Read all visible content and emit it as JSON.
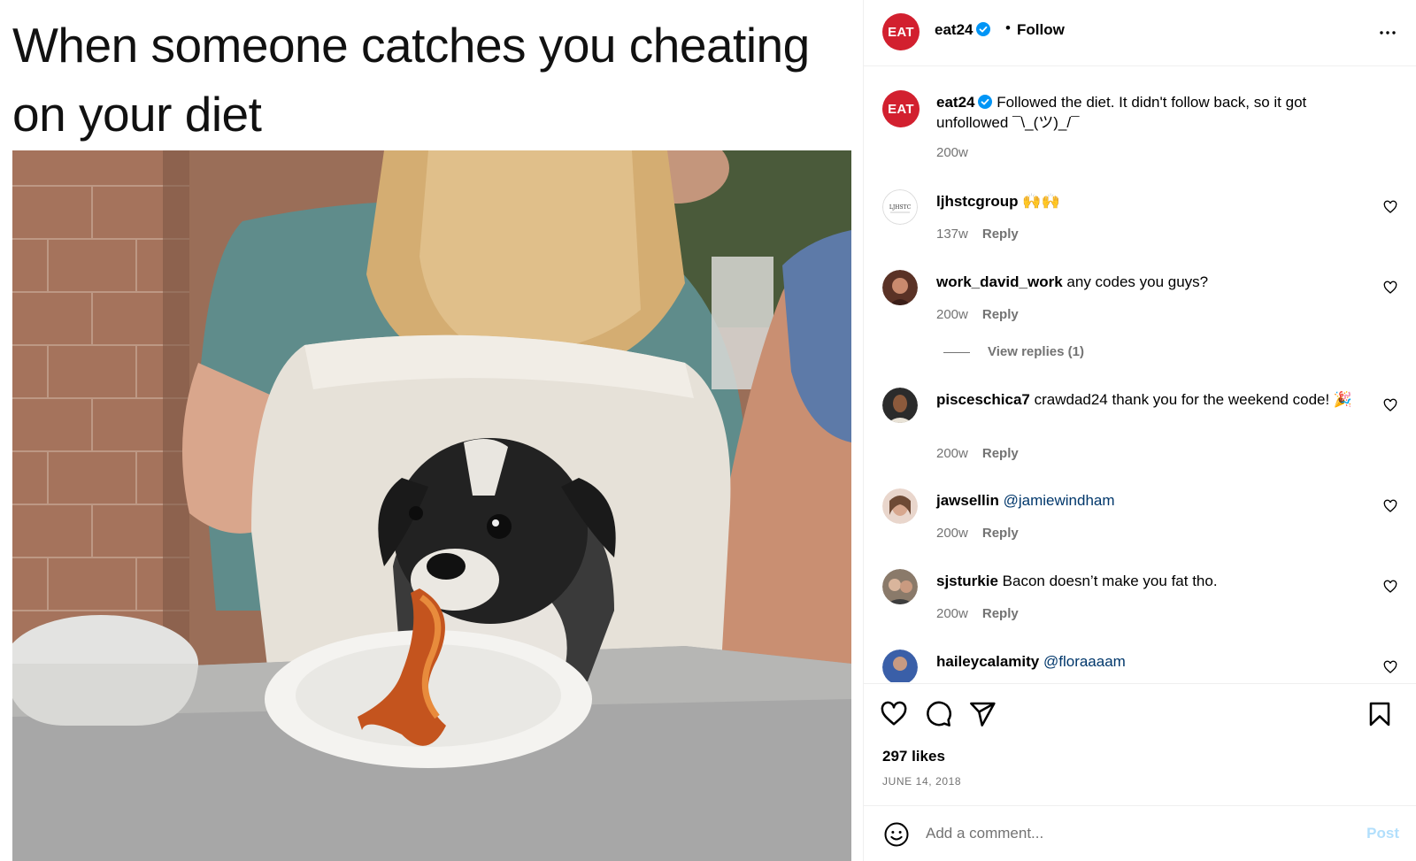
{
  "media": {
    "caption": "When someone catches you cheating on your diet"
  },
  "header": {
    "username": "eat24",
    "avatar_text": "EAT",
    "dot": "•",
    "follow_label": "Follow",
    "verified": true
  },
  "caption_post": {
    "username": "eat24",
    "avatar_text": "EAT",
    "text": "Followed the diet. It didn't follow back, so it got unfollowed ¯\\_(ツ)_/¯",
    "time": "200w"
  },
  "comments": [
    {
      "username": "ljhstcgroup",
      "text": "🙌🙌",
      "time": "137w",
      "reply_label": "Reply"
    },
    {
      "username": "work_david_work",
      "text": "any codes you guys?",
      "time": "200w",
      "reply_label": "Reply",
      "view_replies": "View replies (1)"
    },
    {
      "username": "pisceschica7",
      "text": "crawdad24 thank you for the weekend code! 🎉",
      "time": "200w",
      "reply_label": "Reply"
    },
    {
      "username": "jawsellin",
      "mention": "@jamiewindham",
      "time": "200w",
      "reply_label": "Reply"
    },
    {
      "username": "sjsturkie",
      "text": "Bacon doesn’t make you fat tho.",
      "time": "200w",
      "reply_label": "Reply"
    },
    {
      "username": "haileycalamity",
      "mention": "@floraaaam"
    }
  ],
  "engagement": {
    "likes": "297 likes",
    "date": "JUNE 14, 2018"
  },
  "add_comment": {
    "placeholder": "Add a comment...",
    "post_label": "Post"
  },
  "colors": {
    "brand_red": "#d2202f",
    "verified_blue": "#0095f6",
    "mention": "#00376b",
    "muted": "#737373",
    "post_disabled": "#b2dffc"
  }
}
